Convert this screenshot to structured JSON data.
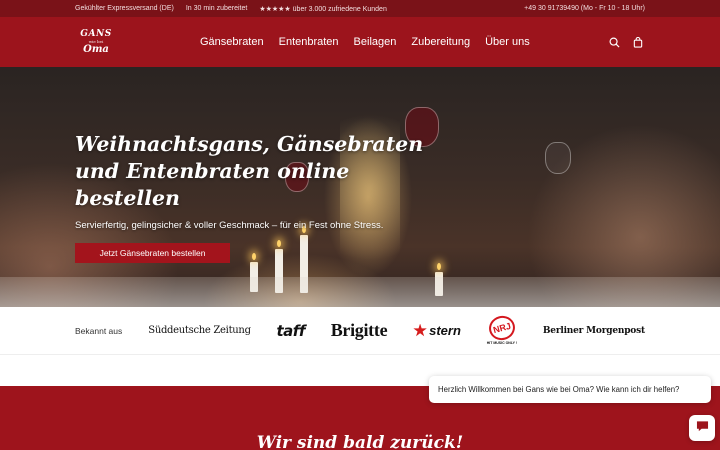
{
  "topbar": {
    "shipping": "Gekühlter Expressversand (DE)",
    "prep": "In 30 min zubereitet",
    "rating_stars": "★★★★★",
    "rating_text": "über 3.000 zufriedene Kunden",
    "phone": "+49 30 91739490 (Mo - Fr 10 - 18 Uhr)"
  },
  "logo": {
    "line1": "GANS",
    "line2": "wie bei",
    "line3": "Oma"
  },
  "nav": {
    "items": [
      "Gänsebraten",
      "Entenbraten",
      "Beilagen",
      "Zubereitung",
      "Über uns"
    ]
  },
  "header_icons": [
    "search-icon",
    "shopping-bag-icon"
  ],
  "hero": {
    "title": "Weihnachtsgans, Gänsebraten und Entenbraten online bestellen",
    "subtitle": "Servierfertig, gelingsicher & voller Geschmack – für ein Fest ohne Stress.",
    "cta": "Jetzt Gänsebraten bestellen"
  },
  "press": {
    "label": "Bekannt aus",
    "logos": {
      "sz": "Süddeutsche Zeitung",
      "taff": "taff",
      "brigitte": "Brigitte",
      "stern": "stern",
      "nrj": "NRJ",
      "nrj_tag": "HIT MUSIC ONLY !",
      "bm": "Berliner Morgenpost"
    }
  },
  "section": {
    "heading": "Wir sind bald zurück!"
  },
  "chat": {
    "message": "Herzlich Willkommen bei Gans wie bei Oma? Wie kann ich dir helfen?"
  },
  "colors": {
    "brand_red": "#9c141c",
    "topbar_red": "#7a1218",
    "cta_red": "#a3141c",
    "press_star_red": "#d61d1d"
  }
}
